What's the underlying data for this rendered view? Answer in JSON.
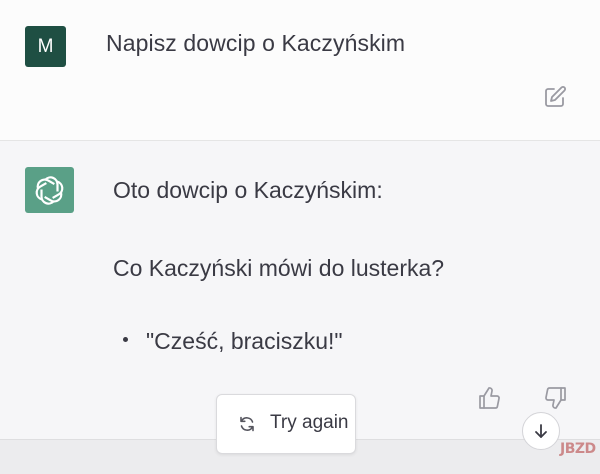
{
  "user_message": {
    "avatar_initial": "M",
    "text": "Napisz dowcip o Kaczyńskim",
    "edit_icon": "edit-icon"
  },
  "assistant_message": {
    "avatar_icon": "chatgpt-logo-icon",
    "intro": "Oto dowcip o Kaczyńskim:",
    "question": "Co Kaczyński mówi do lusterka?",
    "bullets": [
      "\"Cześć, braciszku!\""
    ],
    "feedback": [
      "thumbs-up-icon",
      "thumbs-down-icon"
    ]
  },
  "controls": {
    "try_again_label": "Try again",
    "try_again_icon": "refresh-icon",
    "scroll_icon": "arrow-down-icon"
  },
  "watermark": {
    "text": "JBZD"
  },
  "colors": {
    "user_avatar": "#1f4f43",
    "assistant_avatar": "#5aa087",
    "assistant_bg": "#f6f6f8",
    "text": "#3a3a44"
  }
}
